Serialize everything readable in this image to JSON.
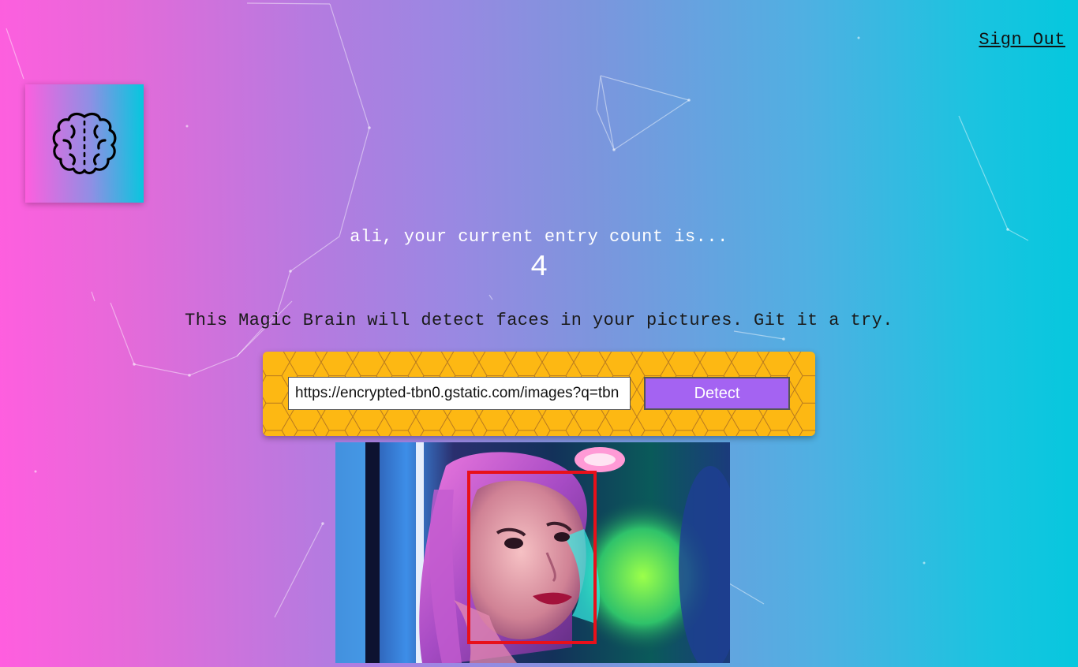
{
  "nav": {
    "sign_out_label": "Sign Out"
  },
  "logo": {
    "icon": "brain-icon"
  },
  "rank": {
    "message": "ali, your current entry count is...",
    "count": "4"
  },
  "description": "This Magic Brain will detect faces in your pictures. Git it a try.",
  "form": {
    "url_value": "https://encrypted-tbn0.gstatic.com/images?q=tbn",
    "detect_label": "Detect"
  },
  "result": {
    "image": "portrait-photo",
    "face_box_color": "#e8101a"
  },
  "colors": {
    "gradient_start": "#ff5edf",
    "gradient_end": "#04c8de",
    "panel": "#fdb813",
    "button": "#a463f2"
  }
}
